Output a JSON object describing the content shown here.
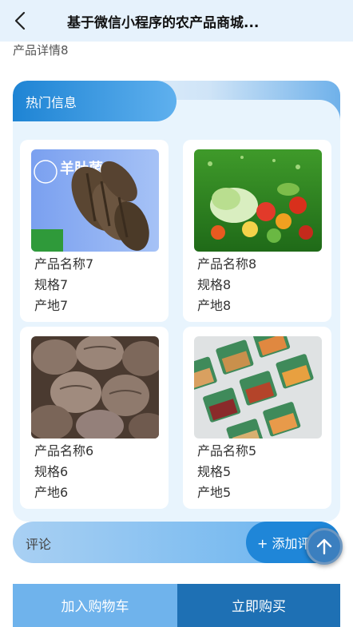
{
  "nav": {
    "title": "基于微信小程序的农产品商城..."
  },
  "detail": {
    "text": "产品详情8"
  },
  "hot": {
    "title": "热门信息",
    "cards": [
      {
        "image": "morel-mushrooms",
        "image_text": "羊肚菌",
        "name": "产品名称7",
        "spec": "规格7",
        "origin": "产地7"
      },
      {
        "image": "fresh-vegetables",
        "name": "产品名称8",
        "spec": "规格8",
        "origin": "产地8"
      },
      {
        "image": "taro",
        "name": "产品名称6",
        "spec": "规格6",
        "origin": "产地6"
      },
      {
        "image": "packaged-produce",
        "name": "产品名称5",
        "spec": "规格5",
        "origin": "产地5"
      }
    ]
  },
  "comments": {
    "label": "评论",
    "add_label": "+ 添加评论"
  },
  "bottom": {
    "cart_label": "加入购物车",
    "buy_label": "立即购买"
  },
  "colors": {
    "accent": "#1e84d4",
    "cart": "#6fb3ec",
    "buy": "#1e70b4",
    "panel": "#e8f4fd"
  }
}
